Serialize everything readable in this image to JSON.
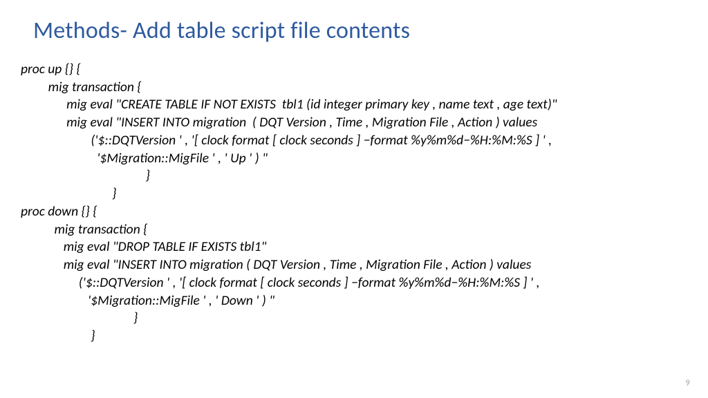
{
  "title": "Methods- Add table script file contents",
  "code": {
    "l1": "proc up {} {",
    "l2": "         mig transaction {",
    "l3": "               mig eval \"CREATE TABLE IF NOT EXISTS  tbl1 (id integer primary key , name text , age text)\"",
    "l4": "               mig eval \"INSERT INTO migration  ( DQT Version , Time , Migration File , Action ) values",
    "l5": "                       ('$::DQTVersion ' , '[ clock format [ clock seconds ] −format %y%m%d−%H:%M:%S ] ' ,",
    "l6": "                         '$Migration::MigFile ' , ' Up ' ) \"",
    "l7": "                                         }",
    "l8": "                              }",
    "l9": "proc down {} {",
    "l10": "           mig transaction {",
    "l11": "              mig eval \"DROP TABLE IF EXISTS tbl1\"",
    "l12": "              mig eval \"INSERT INTO migration ( DQT Version , Time , Migration File , Action ) values",
    "l13": "                   ('$::DQTVersion ' , '[ clock format [ clock seconds ] −format %y%m%d−%H:%M:%S ] ' ,",
    "l14": "                      '$Migration::MigFile ' , ' Down ' ) \"",
    "l15": "                                     }",
    "l16": "                       }"
  },
  "page_number": "9"
}
